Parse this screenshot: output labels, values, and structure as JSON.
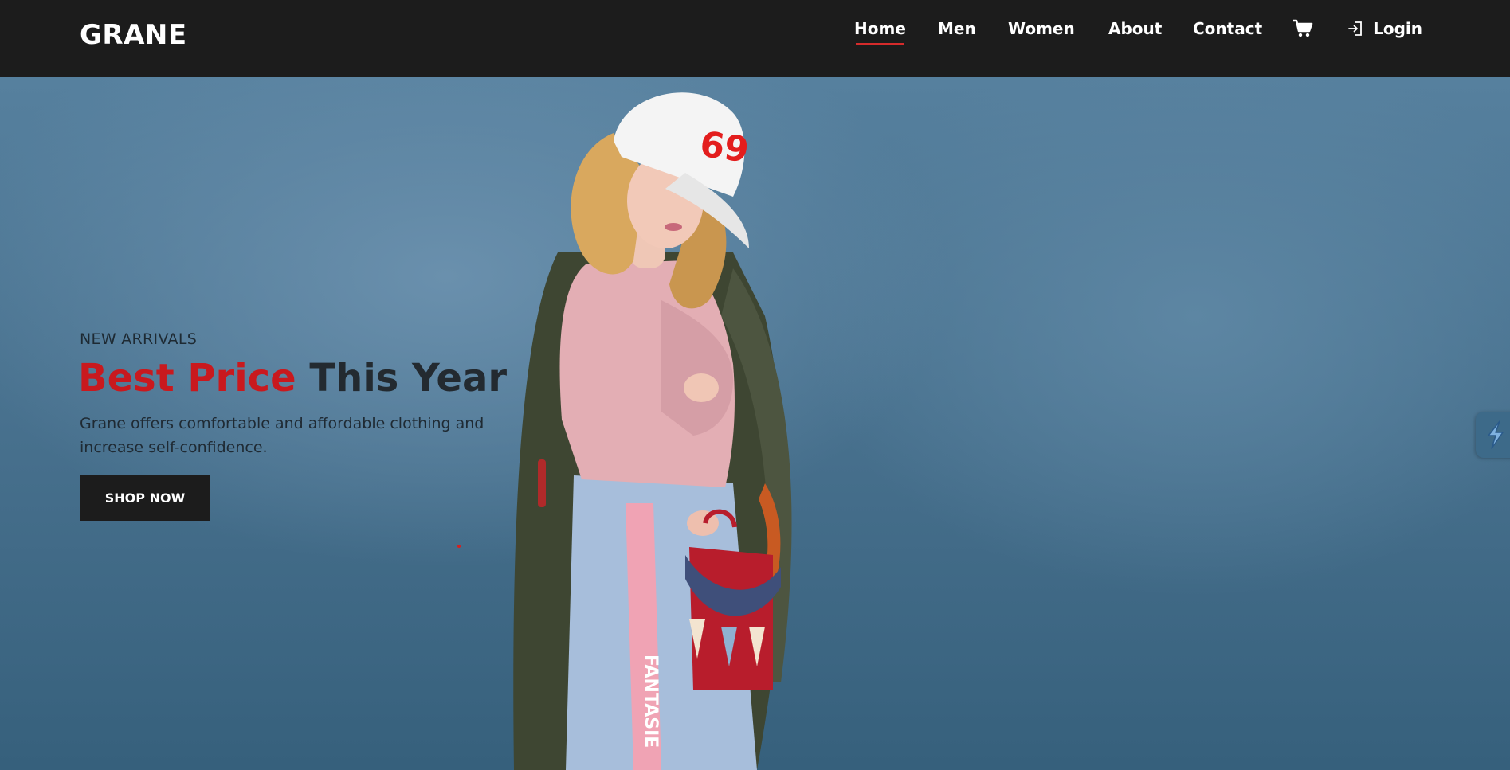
{
  "header": {
    "logo": "GRANE",
    "nav": [
      {
        "label": "Home",
        "active": true
      },
      {
        "label": "Men",
        "active": false
      },
      {
        "label": "Women",
        "active": false
      },
      {
        "label": "About",
        "active": false
      },
      {
        "label": "Contact",
        "active": false
      }
    ],
    "cart_icon": "shopping-cart-icon",
    "login": {
      "label": "Login",
      "icon": "sign-in-icon"
    }
  },
  "hero": {
    "eyebrow": "NEW ARRIVALS",
    "headline_accent": "Best Price",
    "headline_rest": "This Year",
    "description": "Grane offers comfortable and affordable clothing and increase self-confidence.",
    "cta_label": "SHOP NOW",
    "image": "model-photo",
    "cap_number": "69",
    "skirt_text": "FANTASIE"
  },
  "side_widget_icon": "lightning-icon",
  "colors": {
    "header_bg": "#1c1c1c",
    "accent_red": "#c9191e",
    "hero_bg": "#4a7390",
    "button_bg": "#1c1c1c"
  }
}
